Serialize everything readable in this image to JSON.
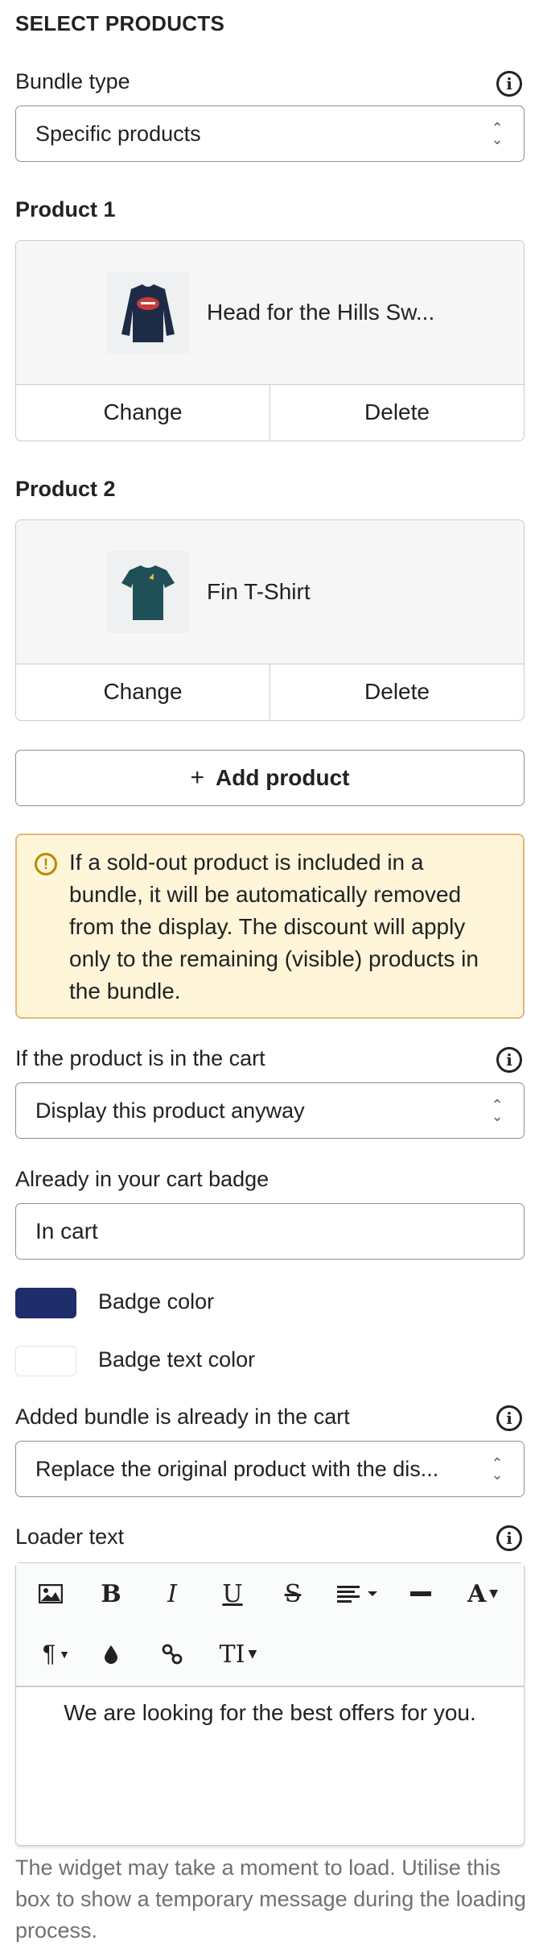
{
  "section": {
    "title": "SELECT PRODUCTS"
  },
  "bundle_type": {
    "label": "Bundle type",
    "value": "Specific products"
  },
  "products": [
    {
      "heading": "Product 1",
      "name": "Head for the Hills Sw...",
      "change": "Change",
      "delete": "Delete",
      "icon": "sweatshirt-thumbnail"
    },
    {
      "heading": "Product 2",
      "name": "Fin T-Shirt",
      "change": "Change",
      "delete": "Delete",
      "icon": "tshirt-thumbnail"
    }
  ],
  "add_product": {
    "plus": "+",
    "label": "Add product"
  },
  "warning": {
    "text": "If a sold-out product is included in a bundle, it will be automatically removed from the display. The discount will apply only to the remaining (visible) products in the bundle."
  },
  "in_cart": {
    "label": "If the product is in the cart",
    "value": "Display this product anyway"
  },
  "badge": {
    "label": "Already in your cart badge",
    "value": "In cart"
  },
  "badge_color": {
    "label": "Badge color",
    "color": "#1f2d6b"
  },
  "badge_text_color": {
    "label": "Badge text color",
    "color": "#ffffff"
  },
  "added_bundle": {
    "label": "Added bundle is already in the cart",
    "value": "Replace the original product with the dis..."
  },
  "loader": {
    "label": "Loader text",
    "text": "We are looking for the best offers for you.",
    "help": "The widget may take a moment to load. Utilise this box to show a temporary message during the loading process."
  },
  "colors": {
    "warning_bg": "#fff5d9",
    "warning_border": "#e1b878",
    "warning_icon": "#b98900"
  }
}
